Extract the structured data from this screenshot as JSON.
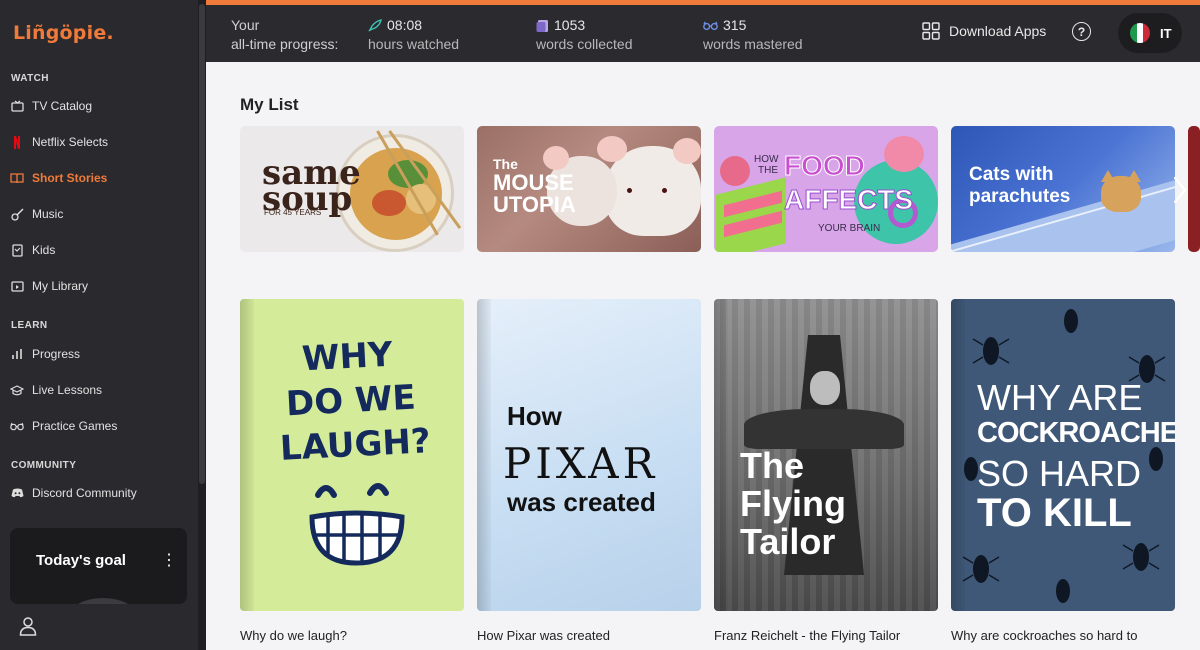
{
  "app": {
    "logo_text": "Liñgöpie.",
    "accent_color": "#f07a3a"
  },
  "sidebar": {
    "sections": [
      {
        "title": "WATCH"
      },
      {
        "title": "LEARN"
      },
      {
        "title": "COMMUNITY"
      }
    ],
    "items": [
      {
        "label": "TV Catalog",
        "icon": "tv-icon"
      },
      {
        "label": "Netflix Selects",
        "icon": "netflix-icon"
      },
      {
        "label": "Short Stories",
        "icon": "book-icon",
        "active": true
      },
      {
        "label": "Music",
        "icon": "guitar-icon"
      },
      {
        "label": "Kids",
        "icon": "kids-icon"
      },
      {
        "label": "My Library",
        "icon": "library-icon"
      },
      {
        "label": "Progress",
        "icon": "progress-icon"
      },
      {
        "label": "Live Lessons",
        "icon": "graduation-cap-icon"
      },
      {
        "label": "Practice Games",
        "icon": "glasses-icon"
      },
      {
        "label": "Discord Community",
        "icon": "discord-icon"
      }
    ],
    "goal_card": {
      "title": "Today's goal",
      "menu": "⋮"
    }
  },
  "topbar": {
    "progress_label_line1": "Your",
    "progress_label_line2": "all-time progress:",
    "stats": [
      {
        "value": "08:08",
        "label": "hours watched",
        "icon": "rocket-icon"
      },
      {
        "value": "1053",
        "label": "words collected",
        "icon": "cards-icon"
      },
      {
        "value": "315",
        "label": "words mastered",
        "icon": "glasses-icon"
      }
    ],
    "download_apps": "Download Apps",
    "help": "?",
    "language_code": "IT"
  },
  "main": {
    "my_list_title": "My List",
    "my_list": [
      {
        "lines": [
          "same",
          "soup",
          "FOR 45 YEARS"
        ]
      },
      {
        "lines": [
          "The",
          "MOUSE",
          "UTOPIA"
        ]
      },
      {
        "lines": [
          "HOW",
          "THE",
          "FOOD",
          "AFFECTS",
          "YOUR BRAIN"
        ]
      },
      {
        "lines": [
          "Cats with",
          "parachutes"
        ]
      }
    ],
    "books": [
      {
        "cover_lines": [
          "WHY",
          "DO WE",
          "LAUGH?"
        ],
        "caption": "Why do we laugh?"
      },
      {
        "cover_lines": [
          "How",
          "PIXAR",
          "was created"
        ],
        "caption": "How Pixar was created"
      },
      {
        "cover_lines": [
          "The",
          "Flying",
          "Tailor"
        ],
        "caption": "Franz Reichelt - the Flying Tailor"
      },
      {
        "cover_lines": [
          "WHY ARE",
          "COCKROACHES",
          "SO HARD",
          "TO KILL"
        ],
        "caption": "Why are cockroaches so hard to"
      }
    ]
  }
}
